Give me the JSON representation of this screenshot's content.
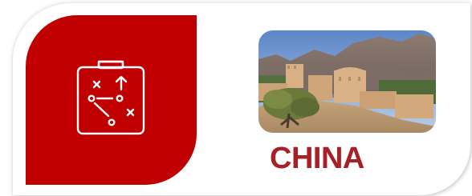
{
  "card": {
    "title": "CHINA",
    "title_color": "#a52127",
    "tile_color": "#c00000",
    "tile_icon": "clipboard-strategy-icon",
    "photo_subject": "desert-fort-with-mountains"
  }
}
